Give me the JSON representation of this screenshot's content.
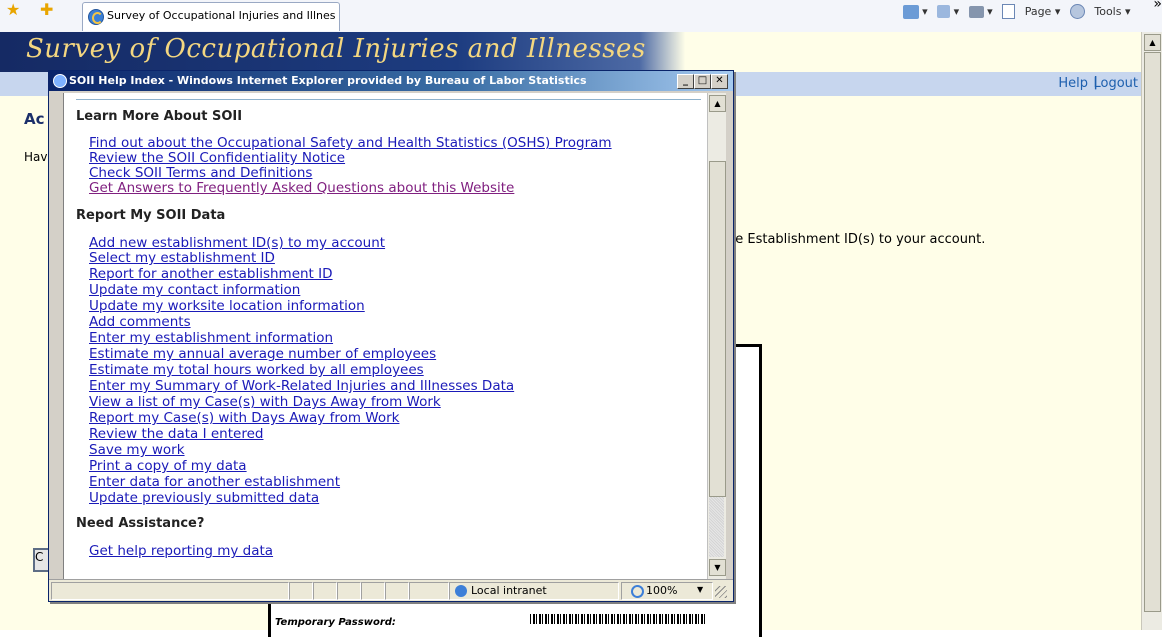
{
  "browser": {
    "tab_title": "Survey of Occupational Injuries and Illnesses - Add Es...",
    "commands": {
      "page": "Page",
      "tools": "Tools",
      "chevron": "»"
    }
  },
  "site": {
    "banner_title": "Survey of Occupational Injuries and Illnesses",
    "nav": {
      "help": "Help",
      "separator": "|",
      "logout": "Logout"
    },
    "heading_partial": "Ac",
    "text_partial": "Hav",
    "sentence_partial": "he Establishment ID(s) to your account.",
    "card_label": "Temporary Password:",
    "button_partial": "C"
  },
  "popup": {
    "title": "SOII Help Index - Windows Internet Explorer provided by Bureau of Labor Statistics",
    "sections": [
      {
        "title": "Learn More About SOII",
        "links": [
          "Find out about the Occupational Safety and Health Statistics (OSHS) Program",
          "Review the SOII Confidentiality Notice",
          "Check SOII Terms and Definitions",
          "Get Answers to Frequently Asked Questions about this Website"
        ]
      },
      {
        "title": "Report My SOII Data",
        "links": [
          "Add new establishment ID(s) to my account",
          "Select my establishment ID",
          "Report for another establishment ID",
          "Update my contact information",
          "Update my worksite location information",
          "Add comments",
          "Enter my establishment information",
          "Estimate my annual average number of employees",
          "Estimate my total hours worked by all employees",
          "Enter my Summary of Work-Related Injuries and Illnesses Data",
          "View a list of my Case(s) with Days Away from Work",
          "Report my Case(s) with Days Away from Work",
          "Review the data I entered",
          "Save my work",
          "Print a copy of my data",
          "Enter data for another establishment",
          "Update previously submitted data"
        ]
      },
      {
        "title": "Need Assistance?",
        "links": [
          "Get help reporting my data"
        ]
      }
    ],
    "status": {
      "zone": "Local intranet",
      "zoom": "100%"
    }
  }
}
